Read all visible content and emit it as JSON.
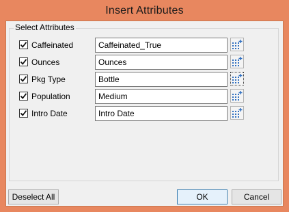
{
  "dialog": {
    "title": "Insert Attributes",
    "group_label": "Select Attributes"
  },
  "attributes": [
    {
      "label": "Caffeinated",
      "checked": true,
      "value": "Caffeinated_True"
    },
    {
      "label": "Ounces",
      "checked": true,
      "value": "Ounces"
    },
    {
      "label": "Pkg Type",
      "checked": true,
      "value": "Bottle"
    },
    {
      "label": "Population",
      "checked": true,
      "value": "Medium"
    },
    {
      "label": "Intro Date",
      "checked": true,
      "value": "Intro Date"
    }
  ],
  "icons": {
    "picker": "grid-picker-icon",
    "check": "checkmark-icon"
  },
  "buttons": {
    "deselect_all": "Deselect All",
    "ok": "OK",
    "cancel": "Cancel"
  },
  "colors": {
    "title_bar": "#e8875f",
    "dialog_bg": "#f0f0f0",
    "picker_blue": "#2f6fc0"
  }
}
